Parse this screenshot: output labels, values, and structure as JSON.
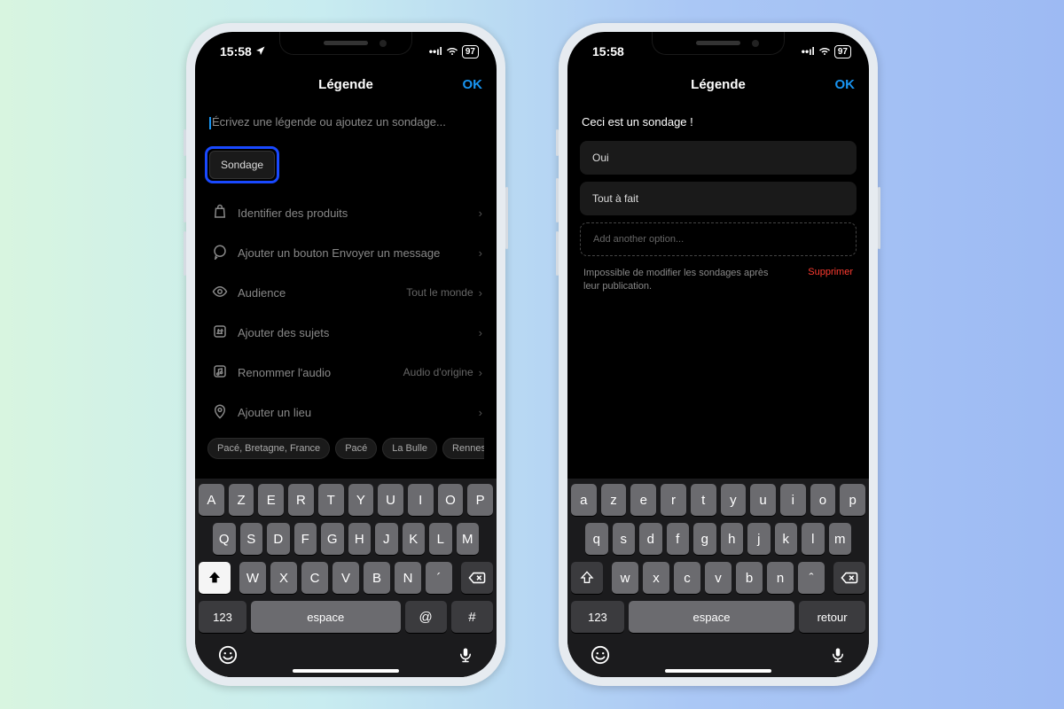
{
  "status": {
    "time": "15:58",
    "battery": "97"
  },
  "header": {
    "title": "Légende",
    "ok": "OK"
  },
  "phone1": {
    "caption_placeholder": "Écrivez une légende ou ajoutez un sondage...",
    "poll_chip": "Sondage",
    "options": [
      {
        "icon": "bag",
        "label": "Identifier des produits",
        "value": ""
      },
      {
        "icon": "chat",
        "label": "Ajouter un bouton Envoyer un message",
        "value": ""
      },
      {
        "icon": "eye",
        "label": "Audience",
        "value": "Tout le monde"
      },
      {
        "icon": "hash",
        "label": "Ajouter des sujets",
        "value": ""
      },
      {
        "icon": "audio",
        "label": "Renommer l'audio",
        "value": "Audio d'origine"
      },
      {
        "icon": "pin",
        "label": "Ajouter un lieu",
        "value": ""
      }
    ],
    "locations": [
      "Pacé, Bretagne, France",
      "Pacé",
      "La Bulle",
      "Rennes"
    ]
  },
  "phone2": {
    "poll_text": "Ceci est un sondage !",
    "opt1": "Oui",
    "opt2": "Tout à fait",
    "add_placeholder": "Add another option...",
    "note": "Impossible de modifier les sondages après leur publication.",
    "delete": "Supprimer"
  },
  "keyboard": {
    "row1": [
      "A",
      "Z",
      "E",
      "R",
      "T",
      "Y",
      "U",
      "I",
      "O",
      "P"
    ],
    "row2": [
      "Q",
      "S",
      "D",
      "F",
      "G",
      "H",
      "J",
      "K",
      "L",
      "M"
    ],
    "row3": [
      "W",
      "X",
      "C",
      "V",
      "B",
      "N",
      "´"
    ],
    "row1_lower": [
      "a",
      "z",
      "e",
      "r",
      "t",
      "y",
      "u",
      "i",
      "o",
      "p"
    ],
    "row2_lower": [
      "q",
      "s",
      "d",
      "f",
      "g",
      "h",
      "j",
      "k",
      "l",
      "m"
    ],
    "row3_lower": [
      "w",
      "x",
      "c",
      "v",
      "b",
      "n",
      "ˆ"
    ],
    "num": "123",
    "space": "espace",
    "return": "retour",
    "at": "@",
    "hash": "#"
  }
}
